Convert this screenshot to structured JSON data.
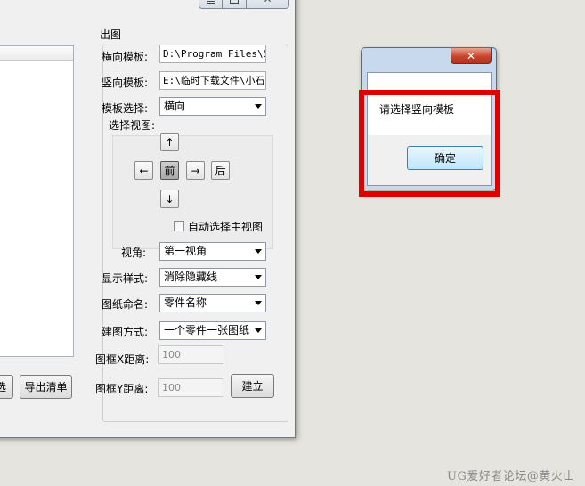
{
  "window": {
    "title_buttons": {
      "minimize": "minimize-icon",
      "maximize": "maximize-icon",
      "close": "✕"
    }
  },
  "left": {
    "select_button_partial": "选",
    "export_button": "导出清单"
  },
  "output_group": {
    "title": "出图",
    "landscape_template": {
      "label": "横向模板:",
      "value": "D:\\Program Files\\SO"
    },
    "portrait_template": {
      "label": "竖向模板:",
      "value": "E:\\临时下载文件\\小石"
    },
    "template_select": {
      "label": "模板选择:",
      "value": "横向"
    },
    "view_select": {
      "label": "选择视图:",
      "up": "↑",
      "down": "↓",
      "left": "←",
      "right": "→",
      "front": "前",
      "back": "后"
    },
    "auto_main_view": {
      "label": "自动选择主视图",
      "checked": false
    },
    "view_angle": {
      "label": "视角:",
      "value": "第一视角"
    },
    "display_style": {
      "label": "显示样式:",
      "value": "消除隐藏线"
    },
    "drawing_name": {
      "label": "图纸命名:",
      "value": "零件名称"
    },
    "build_mode": {
      "label": "建图方式:",
      "value": "一个零件一张图纸"
    },
    "frame_x": {
      "label": "图框X距离:",
      "value": "100"
    },
    "frame_y": {
      "label": "图框Y距离:",
      "value": "100"
    },
    "build_button": "建立"
  },
  "dialog": {
    "close": "✕",
    "message": "请选择竖向模板",
    "ok_button": "确定"
  },
  "highlight_color": "#e00000",
  "watermark": "UG爱好者论坛@黄火山"
}
